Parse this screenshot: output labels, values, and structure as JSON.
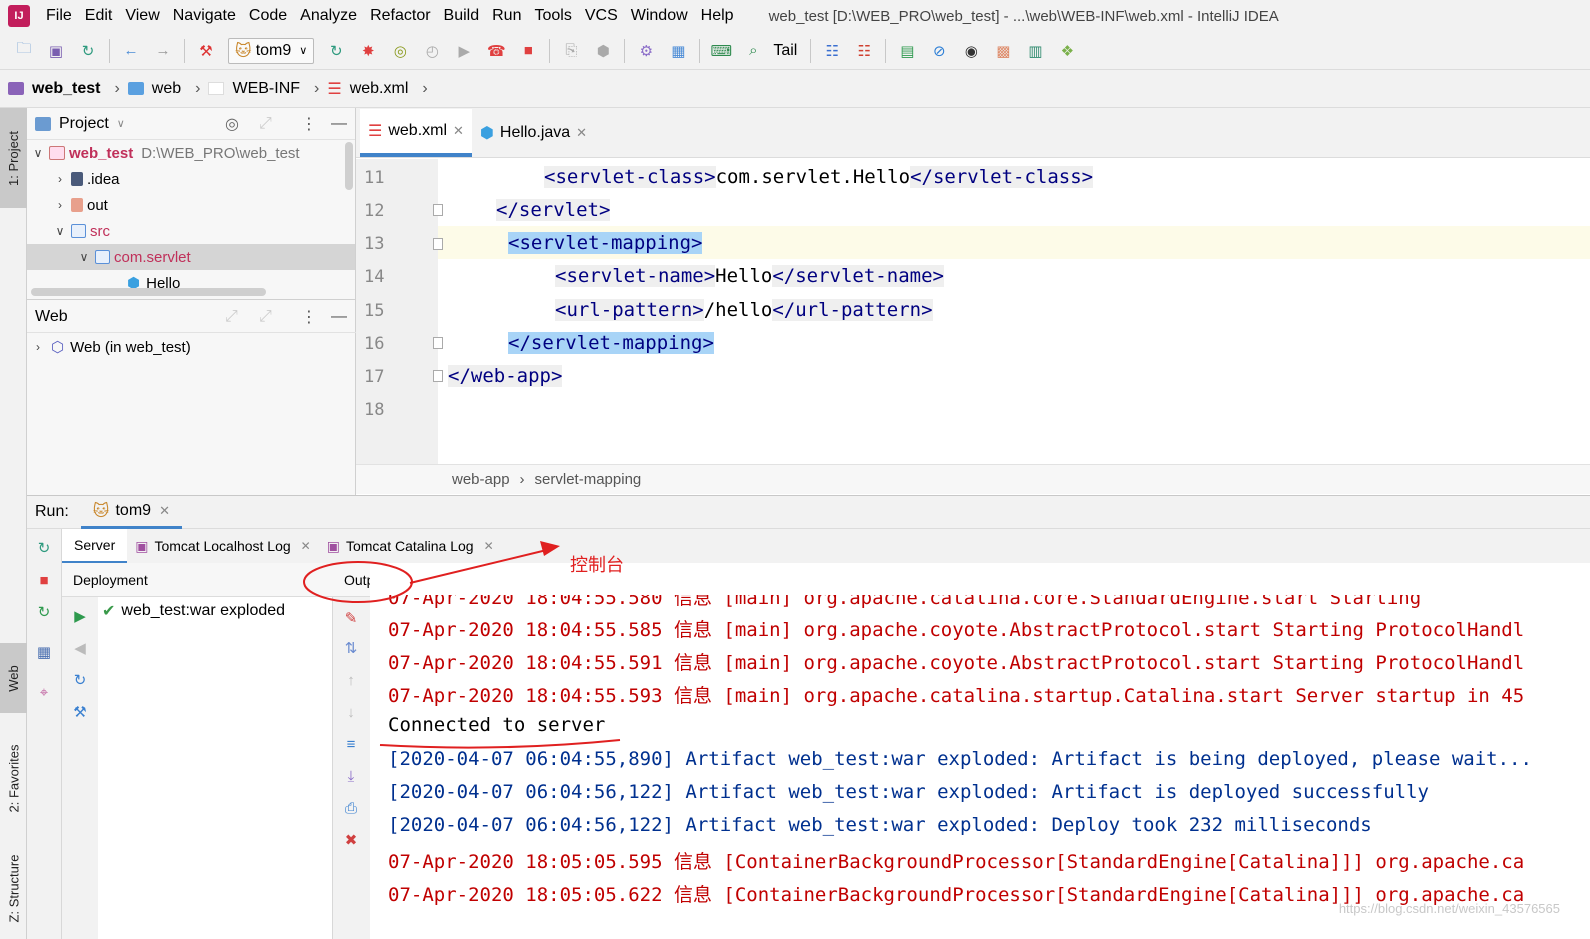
{
  "menubar": {
    "items": [
      "File",
      "Edit",
      "View",
      "Navigate",
      "Code",
      "Analyze",
      "Refactor",
      "Build",
      "Run",
      "Tools",
      "VCS",
      "Window",
      "Help"
    ],
    "title": "web_test [D:\\WEB_PRO\\web_test] - ...\\web\\WEB-INF\\web.xml - IntelliJ IDEA"
  },
  "toolbar": {
    "run_config": "tom9",
    "tail_label": "Tail"
  },
  "breadcrumb": [
    "web_test",
    "web",
    "WEB-INF",
    "web.xml"
  ],
  "side_tabs": {
    "project": "1: Project",
    "web": "Web",
    "favorites": "2: Favorites",
    "structure": "Z: Structure"
  },
  "project_panel": {
    "title": "Project",
    "root_name": "web_test",
    "root_path": "D:\\WEB_PRO\\web_test",
    "items": [
      ".idea",
      "out",
      "src",
      "com.servlet",
      "Hello"
    ]
  },
  "web_panel": {
    "title": "Web",
    "item": "Web (in web_test)"
  },
  "editor": {
    "tabs": [
      "web.xml",
      "Hello.java"
    ],
    "line_numbers": [
      "11",
      "12",
      "13",
      "14",
      "15",
      "16",
      "17",
      "18"
    ],
    "lines": [
      {
        "t1": "<servlet-class>",
        "text": "com.servlet.Hello",
        "t2": "</servlet-class>"
      },
      {
        "t1": "</servlet>"
      },
      {
        "t1": "<servlet-mapping>"
      },
      {
        "t1": "<servlet-name>",
        "text": "Hello",
        "t2": "</servlet-name>"
      },
      {
        "t1": "<url-pattern>",
        "text": "/hello",
        "t2": "</url-pattern>"
      },
      {
        "t1": "</servlet-mapping>"
      },
      {
        "t1": "</web-app>"
      }
    ],
    "breadcrumbs": [
      "web-app",
      "servlet-mapping"
    ]
  },
  "run": {
    "label": "Run:",
    "config": "tom9",
    "subtabs": [
      "Server",
      "Tomcat Localhost Log",
      "Tomcat Catalina Log"
    ],
    "deployment_label": "Deployment",
    "output_label": "Output",
    "deploy_item": "web_test:war exploded"
  },
  "annotation": "控制台",
  "console": {
    "lines": [
      {
        "text": "07-Apr-2020 18:04:55.585 信息 [main] org.apache.coyote.AbstractProtocol.start Starting ProtocolHandl",
        "color": "red"
      },
      {
        "text": "07-Apr-2020 18:04:55.591 信息 [main] org.apache.coyote.AbstractProtocol.start Starting ProtocolHandl",
        "color": "red"
      },
      {
        "text": "07-Apr-2020 18:04:55.593 信息 [main] org.apache.catalina.startup.Catalina.start Server startup in 45",
        "color": "red"
      },
      {
        "text": "Connected to server",
        "color": "black"
      },
      {
        "text": "[2020-04-07 06:04:55,890] Artifact web_test:war exploded: Artifact is being deployed, please wait...",
        "color": "blue"
      },
      {
        "text": "[2020-04-07 06:04:56,122] Artifact web_test:war exploded: Artifact is deployed successfully",
        "color": "blue"
      },
      {
        "text": "[2020-04-07 06:04:56,122] Artifact web_test:war exploded: Deploy took 232 milliseconds",
        "color": "blue"
      },
      {
        "text": "07-Apr-2020 18:05:05.595 信息 [ContainerBackgroundProcessor[StandardEngine[Catalina]]] org.apache.ca",
        "color": "red"
      },
      {
        "text": "07-Apr-2020 18:05:05.622 信息 [ContainerBackgroundProcessor[StandardEngine[Catalina]]] org.apache.ca",
        "color": "red"
      }
    ]
  },
  "watermark": "https://blog.csdn.net/weixin_43576565"
}
